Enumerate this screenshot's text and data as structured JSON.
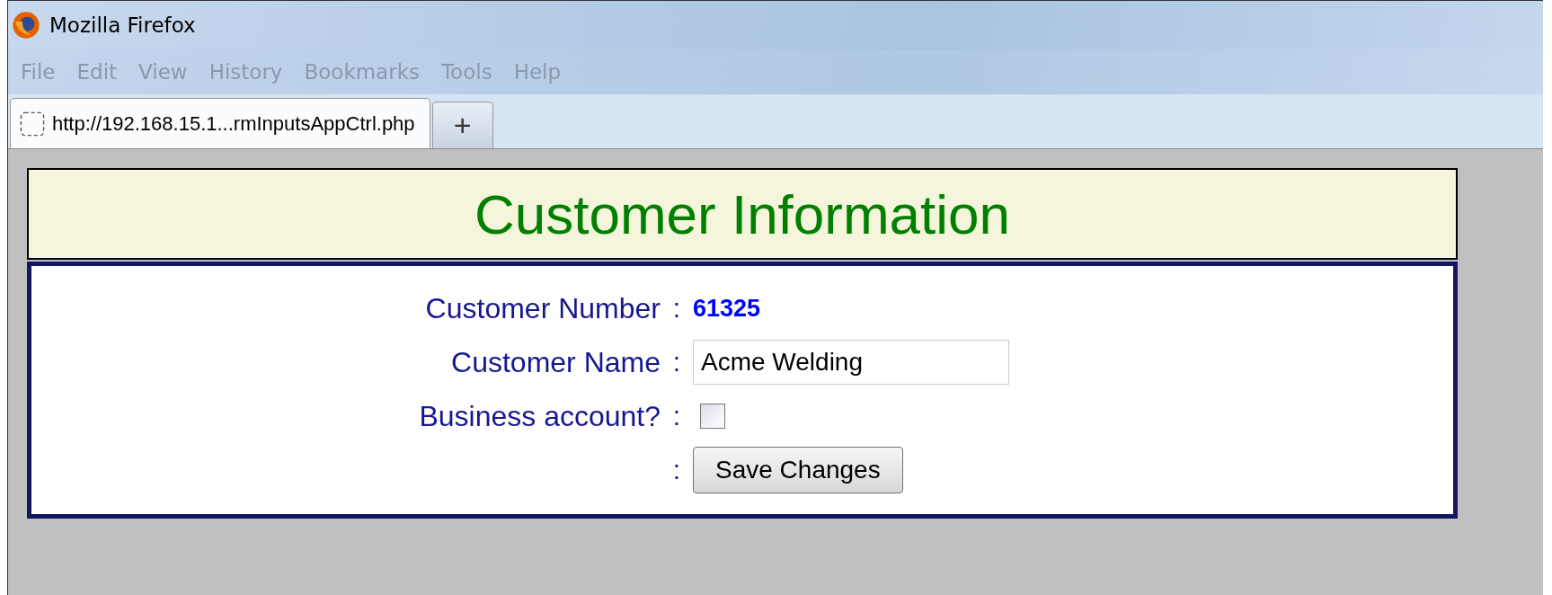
{
  "window": {
    "title": "Mozilla Firefox"
  },
  "menu": [
    "File",
    "Edit",
    "View",
    "History",
    "Bookmarks",
    "Tools",
    "Help"
  ],
  "tabs": [
    {
      "label": "http://192.168.15.1...rmInputsAppCtrl.php",
      "selected": true
    }
  ],
  "new_tab": "+",
  "page": {
    "heading": "Customer Information",
    "rows": [
      {
        "kind": "text",
        "label": "Customer Number",
        "colon": ":",
        "value": "61325"
      },
      {
        "kind": "input",
        "label": "Customer Name",
        "colon": ":",
        "value": "Acme Welding"
      },
      {
        "kind": "checkbox",
        "label": "Business account?",
        "colon": ":",
        "checked": false
      },
      {
        "kind": "button",
        "colon": ":",
        "value": "Save Changes"
      }
    ]
  }
}
